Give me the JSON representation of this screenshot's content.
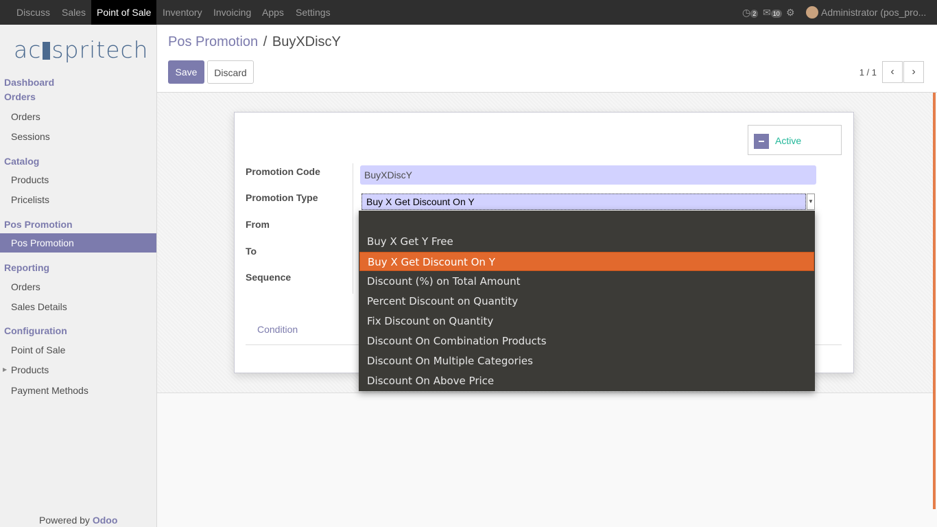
{
  "topbar": {
    "menu": [
      "Discuss",
      "Sales",
      "Point of Sale",
      "Inventory",
      "Invoicing",
      "Apps",
      "Settings"
    ],
    "active": "Point of Sale",
    "badge_activity": "2",
    "badge_messages": "10",
    "user": "Administrator (pos_pro..."
  },
  "sidebar": {
    "logo": {
      "left": "ac",
      "right": "spritech"
    },
    "sections": [
      {
        "title": "Dashboard"
      },
      {
        "title": "Orders",
        "items": [
          "Orders",
          "Sessions"
        ]
      },
      {
        "title": "Catalog",
        "items": [
          "Products",
          "Pricelists"
        ]
      },
      {
        "title": "Pos Promotion",
        "items": [
          "Pos Promotion"
        ]
      },
      {
        "title": "Reporting",
        "items": [
          "Orders",
          "Sales Details"
        ]
      },
      {
        "title": "Configuration",
        "items": [
          "Point of Sale",
          "Products",
          "Payment Methods"
        ]
      }
    ],
    "active_item": "Pos Promotion",
    "powered_prefix": "Powered by",
    "powered_brand": "Odoo"
  },
  "control_panel": {
    "breadcrumb_parent": "Pos Promotion",
    "breadcrumb_sep": "/",
    "breadcrumb_current": "BuyXDiscY",
    "save_label": "Save",
    "discard_label": "Discard",
    "pager": "1 / 1"
  },
  "form": {
    "active_label": "Active",
    "labels": {
      "code": "Promotion Code",
      "type": "Promotion Type",
      "from": "From",
      "to": "To",
      "sequence": "Sequence"
    },
    "code_value": "BuyXDiscY",
    "type_value": "Buy X Get Discount On Y",
    "tab_condition": "Condition"
  },
  "dropdown": {
    "options": [
      "",
      "Buy X Get Y Free",
      "Buy X Get Discount On Y",
      "Discount (%) on Total Amount",
      "Percent Discount on Quantity",
      "Fix Discount on Quantity",
      "Discount On Combination Products",
      "Discount On Multiple Categories",
      "Discount On Above Price"
    ],
    "selected": "Buy X Get Discount On Y"
  },
  "colors": {
    "brand": "#7c7bad",
    "selected_option": "#e2692d",
    "active_green": "#21b799"
  }
}
